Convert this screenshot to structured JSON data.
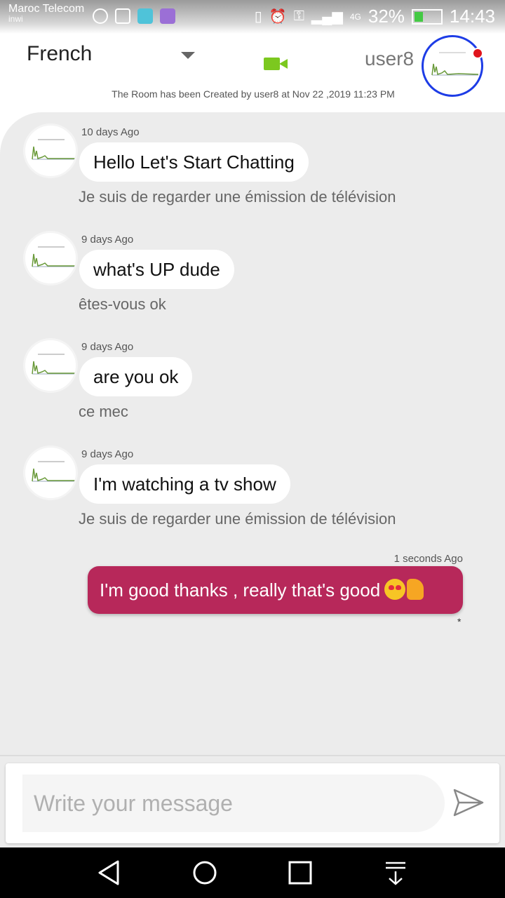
{
  "status_bar": {
    "carrier": "Maroc Telecom",
    "carrier_sub": "inwi",
    "network": "4G",
    "battery": "32%",
    "time": "14:43"
  },
  "header": {
    "language": "French",
    "username": "user8",
    "room_info": "The Room has been Created by user8  at Nov 22 ,2019 11:23 PM"
  },
  "messages": [
    {
      "time": "10 days Ago",
      "text": "Hello Let's Start Chatting",
      "translation": "Je suis de regarder une émission de télévision"
    },
    {
      "time": "9 days Ago",
      "text": "what's UP dude",
      "translation": "êtes-vous ok"
    },
    {
      "time": "9 days Ago",
      "text": "are you ok",
      "translation": "ce mec"
    },
    {
      "time": "9 days Ago",
      "text": "I'm watching a tv show",
      "translation": "Je suis de regarder une émission de télévision"
    }
  ],
  "outgoing": {
    "time": "1 seconds Ago",
    "text": "I'm good thanks , really that's good",
    "mark": "*"
  },
  "composer": {
    "placeholder": "Write your message"
  },
  "colors": {
    "accent": "#b7285a",
    "video_icon": "#7cc81f",
    "avatar_ring": "#1d3ce6",
    "online_dot": "#e0141c"
  }
}
